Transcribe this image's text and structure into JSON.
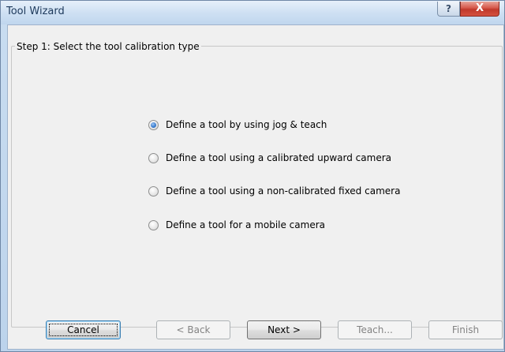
{
  "window": {
    "title": "Tool Wizard",
    "help_label": "?",
    "close_label": "X"
  },
  "wizard": {
    "step_caption": "Step 1: Select the tool calibration type",
    "options": [
      {
        "label": "Define a tool by using jog & teach",
        "selected": true
      },
      {
        "label": "Define a tool using a calibrated upward camera",
        "selected": false
      },
      {
        "label": "Define a tool using a non-calibrated fixed camera",
        "selected": false
      },
      {
        "label": "Define a tool for a mobile camera",
        "selected": false
      }
    ]
  },
  "buttons": {
    "cancel": "Cancel",
    "back": "< Back",
    "next": "Next >",
    "teach": "Teach...",
    "finish": "Finish"
  },
  "colors": {
    "accent": "#3c7fb1",
    "close_red": "#c0392b",
    "dialog_bg": "#f0f0f0"
  }
}
